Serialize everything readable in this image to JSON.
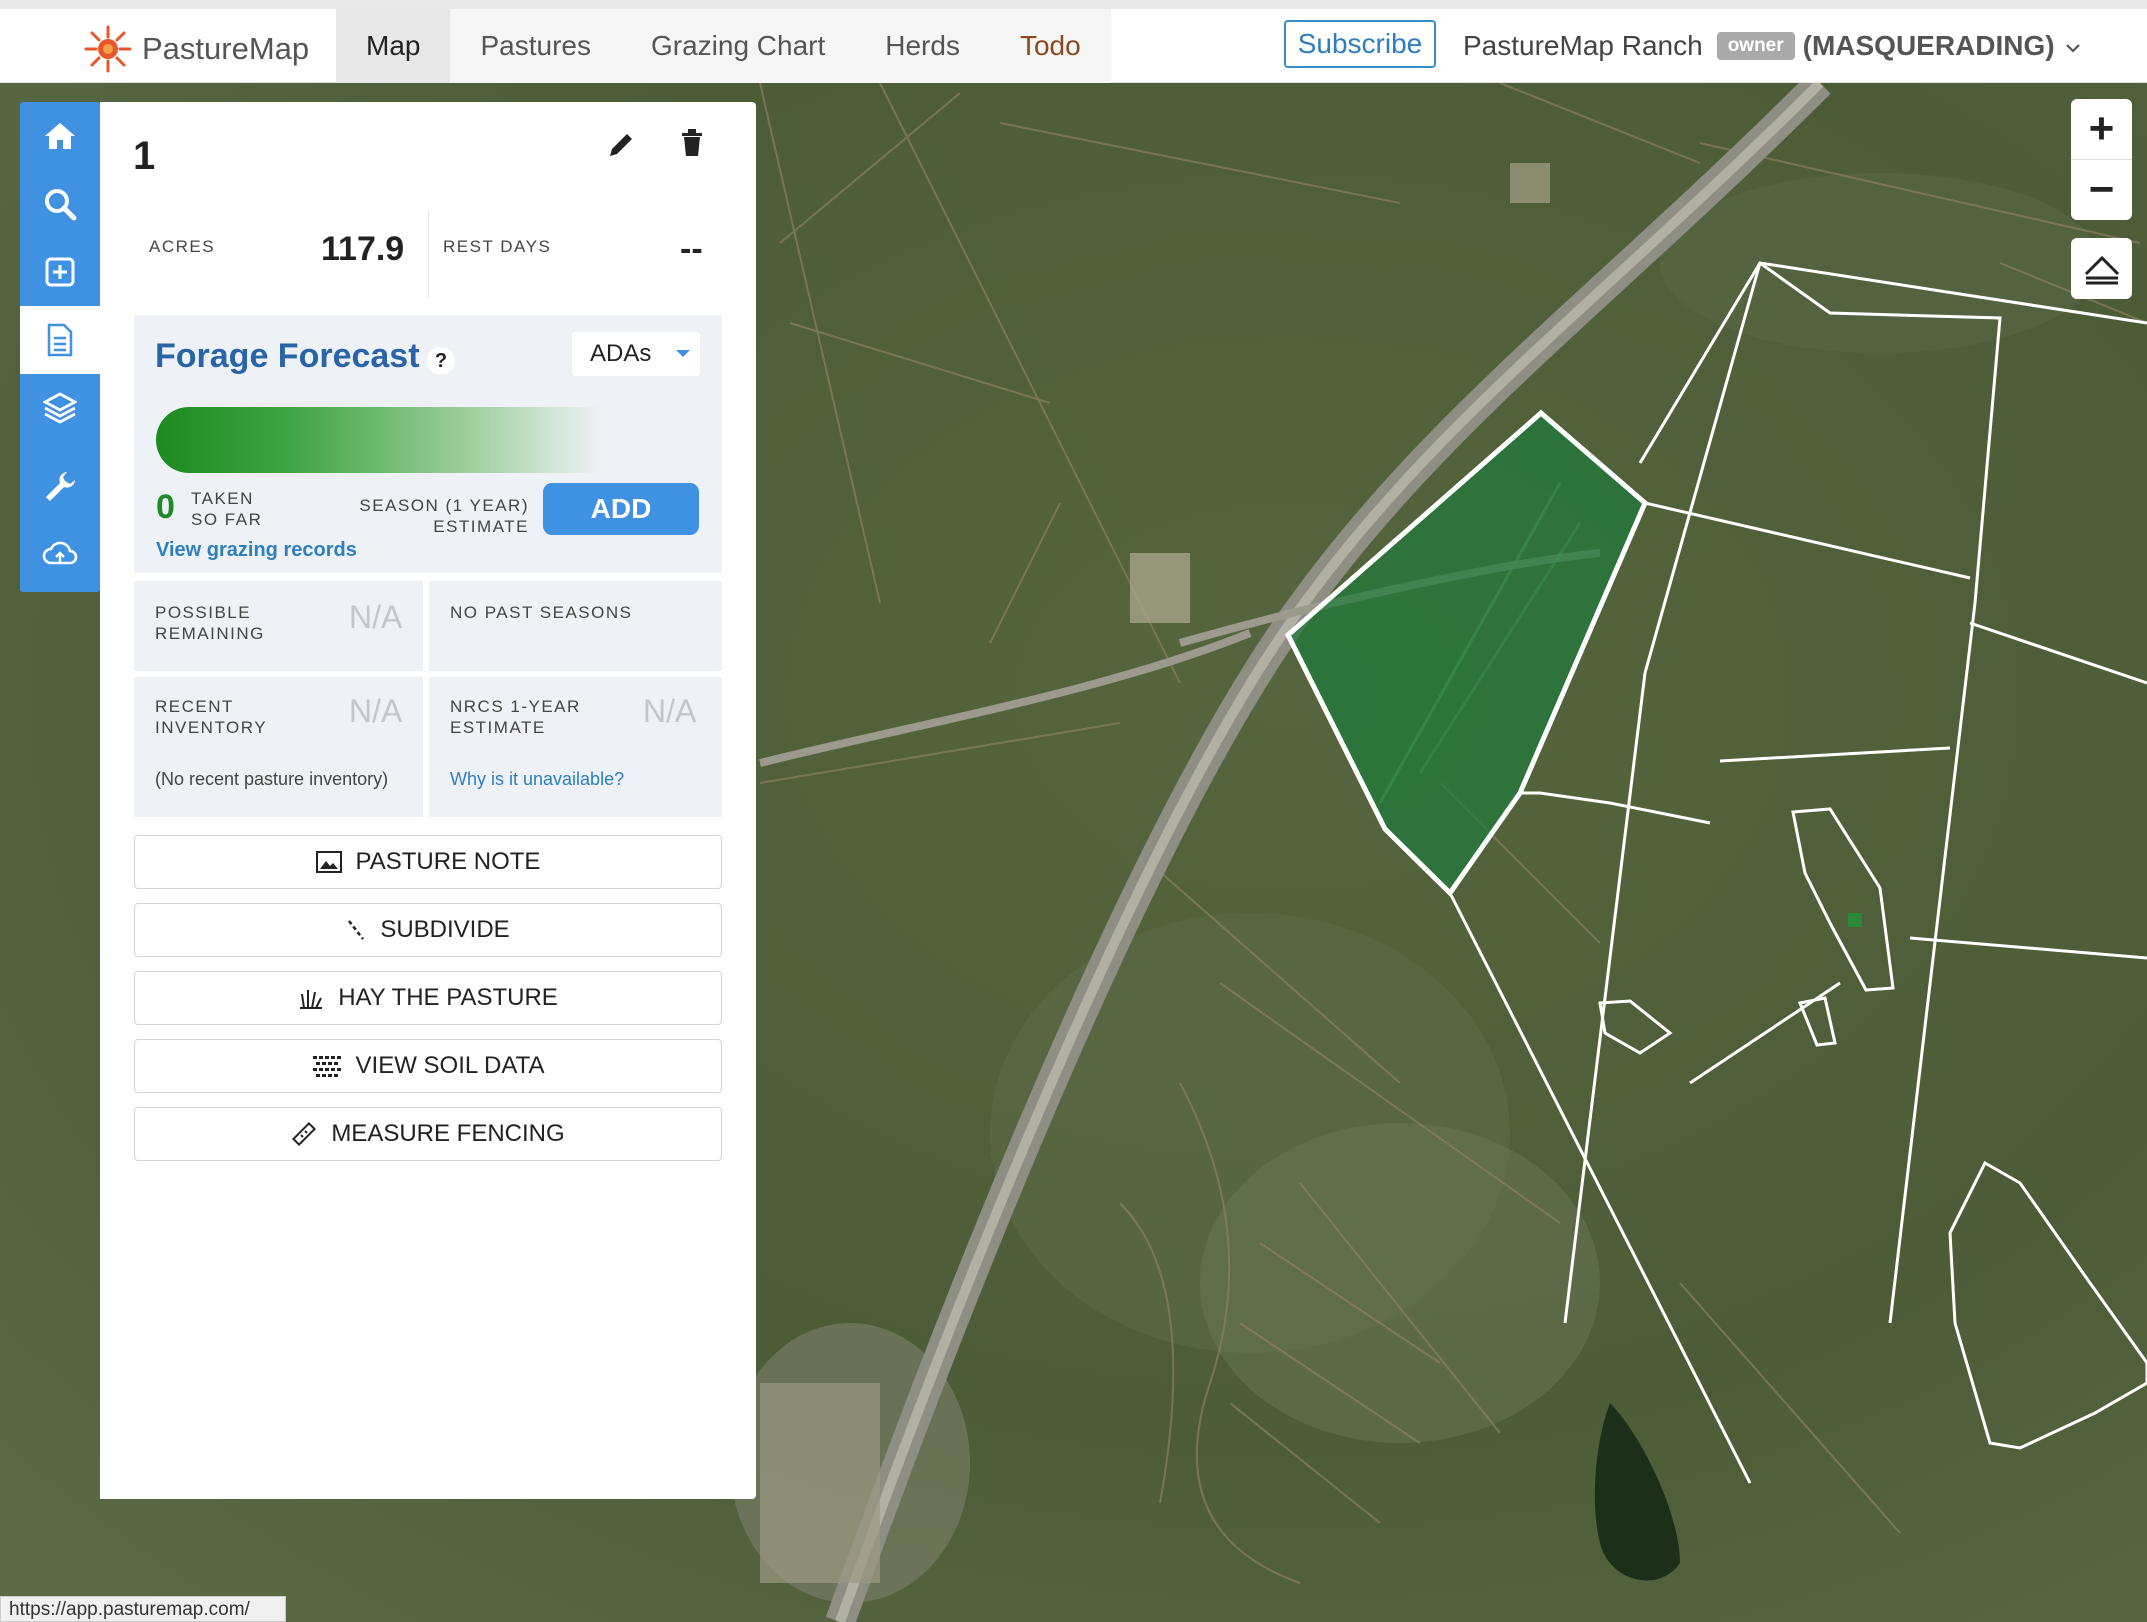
{
  "app": {
    "logo_text": "PastureMap"
  },
  "nav": {
    "tabs": [
      {
        "label": "Map"
      },
      {
        "label": "Pastures"
      },
      {
        "label": "Grazing Chart"
      },
      {
        "label": "Herds"
      },
      {
        "label": "Todo"
      }
    ]
  },
  "header": {
    "subscribe_label": "Subscribe",
    "ranch_name": "PastureMap Ranch",
    "role_badge": "owner",
    "masquerading": "(MASQUERADING)"
  },
  "toolbar": {
    "items": [
      "home-icon",
      "search-icon",
      "add-pasture-icon",
      "pasture-details-icon",
      "layers-icon",
      "tools-icon",
      "cloud-sync-icon"
    ],
    "active": "pasture-details-icon"
  },
  "pasture": {
    "name": "1",
    "acres_label": "ACRES",
    "acres_value": "117.9",
    "rest_days_label": "REST DAYS",
    "rest_days_value": "--"
  },
  "forage": {
    "title": "Forage Forecast",
    "help": "?",
    "unit_selected": "ADAs",
    "taken_value": "0",
    "taken_line1": "TAKEN",
    "taken_line2": "SO FAR",
    "season_line1": "SEASON (1 YEAR)",
    "season_line2": "ESTIMATE",
    "add_label": "ADD",
    "records_link": "View grazing records"
  },
  "cells": {
    "possible_line1": "POSSIBLE",
    "possible_line2": "REMAINING",
    "possible_value": "N/A",
    "past_seasons": "NO PAST SEASONS",
    "recent_line1": "RECENT",
    "recent_line2": "INVENTORY",
    "recent_value": "N/A",
    "recent_note": "(No recent pasture inventory)",
    "nrcs_line1": "NRCS 1-YEAR",
    "nrcs_line2": "ESTIMATE",
    "nrcs_value": "N/A",
    "nrcs_link": "Why is it unavailable?"
  },
  "actions": [
    {
      "label": "PASTURE NOTE",
      "icon": "image-icon"
    },
    {
      "label": "SUBDIVIDE",
      "icon": "subdivide-icon"
    },
    {
      "label": "HAY THE PASTURE",
      "icon": "hay-icon"
    },
    {
      "label": "VIEW SOIL DATA",
      "icon": "soil-grid-icon"
    },
    {
      "label": "MEASURE FENCING",
      "icon": "ruler-icon"
    }
  ],
  "map_controls": {
    "zoom_in": "+",
    "zoom_out": "−"
  },
  "status_url": "https://app.pasturemap.com/",
  "colors": {
    "accent": "#3f91e2",
    "forage_title": "#2a64a8",
    "selected_pasture": "#1e7a3c",
    "pasture_outline": "#ffffff"
  }
}
